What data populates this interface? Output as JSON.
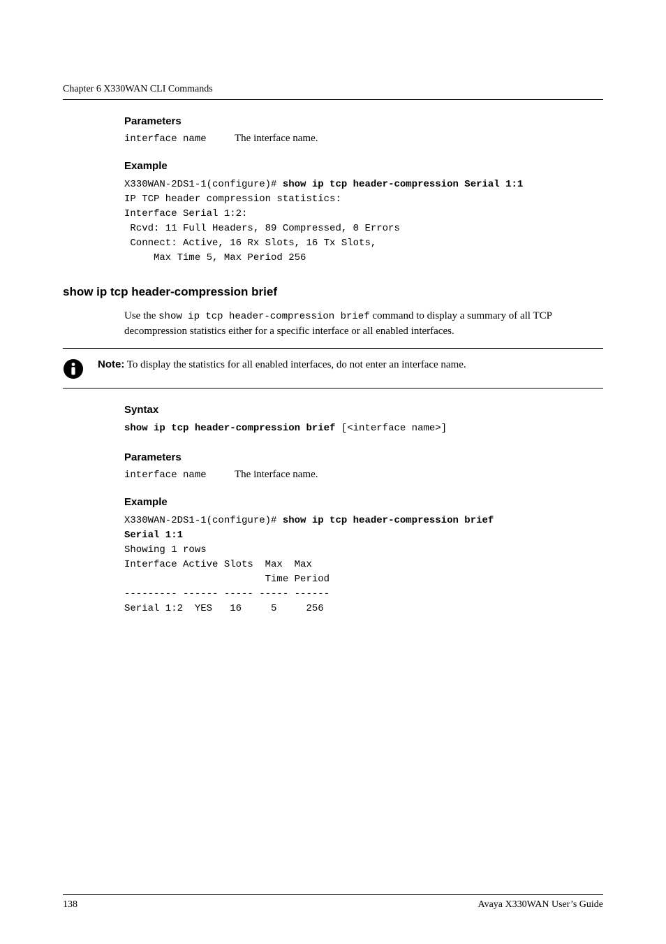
{
  "running_head": "Chapter 6    X330WAN CLI Commands",
  "headings": {
    "parameters1": "Parameters",
    "example1": "Example",
    "cmd": "show ip tcp header-compression brief",
    "syntax": "Syntax",
    "parameters2": "Parameters",
    "example2": "Example"
  },
  "param1": {
    "name": "interface name",
    "desc": "The interface name."
  },
  "example1": {
    "prompt": "X330WAN-2DS1-1(configure)# ",
    "cmd_bold": "show ip tcp header-compression Serial 1:1",
    "line1": "IP TCP header compression statistics:",
    "line2": "Interface Serial 1:2:",
    "line3": " Rcvd: 11 Full Headers, 89 Compressed, 0 Errors",
    "line4": " Connect: Active, 16 Rx Slots, 16 Tx Slots,",
    "line5": "     Max Time 5, Max Period 256"
  },
  "cmd_desc": {
    "lead": "Use the ",
    "code": "show ip tcp header-compression brief",
    "tail": " command to display a summary of all TCP decompression statistics either for a specific interface or all enabled interfaces."
  },
  "note": {
    "label": "Note:",
    "text": "  To display the statistics for all enabled interfaces, do not enter an interface name."
  },
  "syntax_line": {
    "bold": "show ip tcp header-compression brief",
    "rest": " [<interface name>]"
  },
  "param2": {
    "name": "interface name",
    "desc": "The interface name."
  },
  "example2": {
    "prompt": "X330WAN-2DS1-1(configure)# ",
    "cmd_bold_a": "show ip tcp header-compression brief ",
    "cmd_bold_b": "Serial 1:1",
    "line1": "Showing 1 rows",
    "line2": "Interface Active Slots  Max  Max",
    "line3": "                        Time Period",
    "line4": "--------- ------ ----- ----- ------",
    "line5": "Serial 1:2  YES   16     5     256"
  },
  "footer": {
    "page": "138",
    "guide": "Avaya X330WAN User’s Guide"
  }
}
